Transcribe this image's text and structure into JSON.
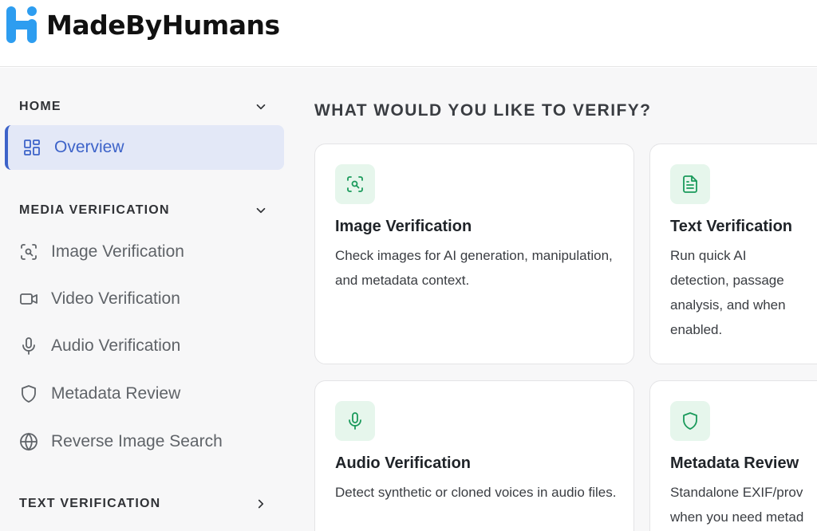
{
  "brand": {
    "name": "MadeByHumans",
    "colors": {
      "primary": "#3d63c9",
      "logo_blue": "#2d9df0",
      "accent_green": "#1a9a5b",
      "icon_bg": "#e6f6ec"
    }
  },
  "sidebar": {
    "sections": [
      {
        "label": "HOME",
        "chevron": "chevron-down-icon",
        "items": [
          {
            "label": "Overview",
            "icon": "grid-icon",
            "active": true
          }
        ]
      },
      {
        "label": "MEDIA VERIFICATION",
        "chevron": "chevron-down-icon",
        "items": [
          {
            "label": "Image Verification",
            "icon": "image-scan-icon"
          },
          {
            "label": "Video Verification",
            "icon": "video-camera-icon"
          },
          {
            "label": "Audio Verification",
            "icon": "microphone-icon"
          },
          {
            "label": "Metadata Review",
            "icon": "shield-icon"
          },
          {
            "label": "Reverse Image Search",
            "icon": "globe-icon"
          }
        ]
      },
      {
        "label": "TEXT VERIFICATION",
        "chevron": "chevron-right-icon",
        "items": []
      }
    ]
  },
  "main": {
    "title": "WHAT WOULD YOU LIKE TO VERIFY?",
    "cards": [
      {
        "title": "Image Verification",
        "description": "Check images for AI generation, manipulation, and metadata context.",
        "icon": "image-scan-icon"
      },
      {
        "title": "Text Verification",
        "description": "Run quick AI detection, passage analysis, and when enabled.",
        "icon": "document-icon"
      },
      {
        "title": "Audio Verification",
        "description": "Detect synthetic or cloned voices in audio files.",
        "icon": "microphone-icon"
      },
      {
        "title": "Metadata Review",
        "description": "Standalone EXIF/prov when you need metad",
        "icon": "shield-icon"
      }
    ]
  }
}
